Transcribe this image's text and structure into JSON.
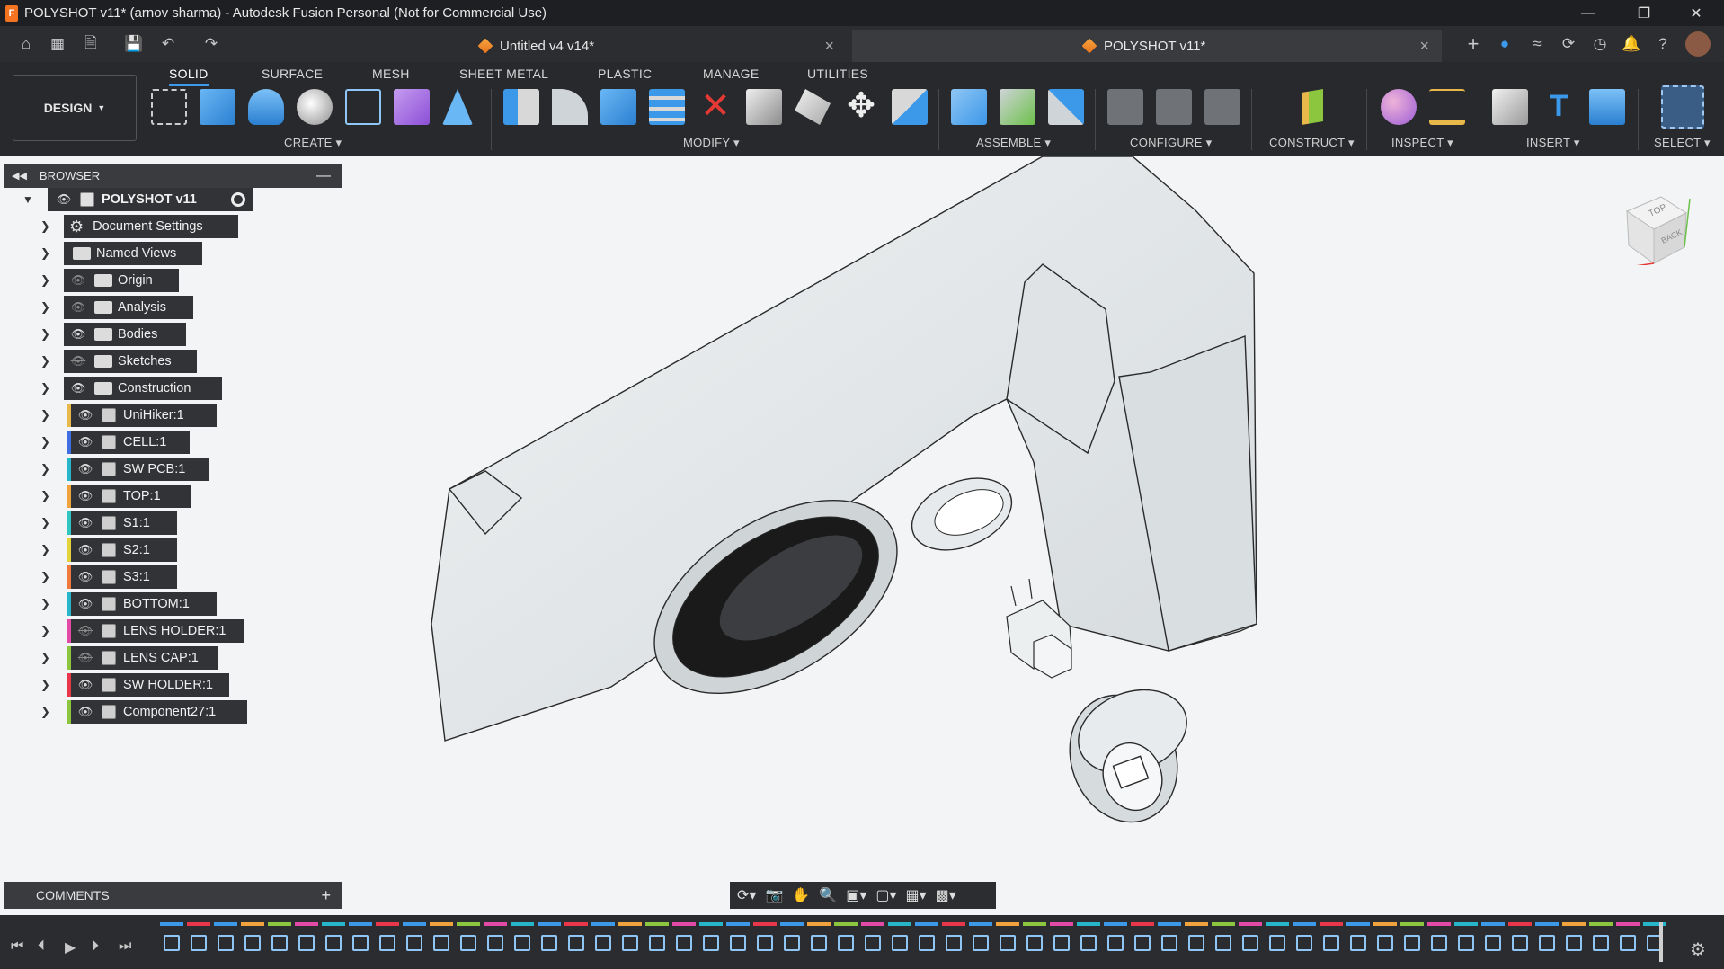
{
  "window": {
    "title": "POLYSHOT v11* (arnov sharma) - Autodesk Fusion Personal (Not for Commercial Use)",
    "app_icon_letter": "F",
    "controls": [
      "minimize",
      "restore",
      "close"
    ]
  },
  "tabs": [
    {
      "label": "Untitled v4 v14*",
      "active": false
    },
    {
      "label": "POLYSHOT v11*",
      "active": true
    }
  ],
  "ribbon": {
    "workspace": "DESIGN",
    "workspace_tabs": [
      "SOLID",
      "SURFACE",
      "MESH",
      "SHEET METAL",
      "PLASTIC",
      "MANAGE",
      "UTILITIES"
    ],
    "active_tab": "SOLID",
    "groups": [
      "CREATE",
      "MODIFY",
      "ASSEMBLE",
      "CONFIGURE",
      "CONSTRUCT",
      "INSPECT",
      "INSERT",
      "SELECT"
    ]
  },
  "browser": {
    "title": "BROWSER",
    "root": "POLYSHOT v11",
    "items": [
      {
        "label": "Document Settings",
        "icon": "gear-icon",
        "visible": null,
        "color": ""
      },
      {
        "label": "Named Views",
        "icon": "folder-icon",
        "visible": null,
        "color": ""
      },
      {
        "label": "Origin",
        "icon": "folder-icon",
        "visible": false,
        "color": ""
      },
      {
        "label": "Analysis",
        "icon": "folder-icon",
        "visible": false,
        "color": ""
      },
      {
        "label": "Bodies",
        "icon": "folder-icon",
        "visible": true,
        "color": ""
      },
      {
        "label": "Sketches",
        "icon": "folder-icon",
        "visible": false,
        "color": ""
      },
      {
        "label": "Construction",
        "icon": "folder-icon",
        "visible": true,
        "color": ""
      },
      {
        "label": "UniHiker:1",
        "icon": "component-icon",
        "visible": true,
        "color": "#e8b84a"
      },
      {
        "label": "CELL:1",
        "icon": "component-icon",
        "visible": true,
        "color": "#3e6ee0"
      },
      {
        "label": "SW PCB:1",
        "icon": "component-icon",
        "visible": true,
        "color": "#27b5c9"
      },
      {
        "label": "TOP:1",
        "icon": "component-icon",
        "visible": true,
        "color": "#f0a23c"
      },
      {
        "label": "S1:1",
        "icon": "component-icon",
        "visible": true,
        "color": "#2fc5c0"
      },
      {
        "label": "S2:1",
        "icon": "component-icon",
        "visible": true,
        "color": "#e3d23a"
      },
      {
        "label": "S3:1",
        "icon": "component-icon",
        "visible": true,
        "color": "#f07a3c"
      },
      {
        "label": "BOTTOM:1",
        "icon": "component-icon",
        "visible": true,
        "color": "#27b5c9"
      },
      {
        "label": "LENS HOLDER:1",
        "icon": "component-icon",
        "visible": false,
        "color": "#e24aa6"
      },
      {
        "label": "LENS CAP:1",
        "icon": "component-icon",
        "visible": false,
        "color": "#8cc63f"
      },
      {
        "label": "SW HOLDER:1",
        "icon": "component-icon",
        "visible": true,
        "color": "#e8364a"
      },
      {
        "label": "Component27:1",
        "icon": "assembly-icon",
        "visible": true,
        "color": "#8cc63f"
      }
    ]
  },
  "comments": {
    "title": "COMMENTS"
  },
  "viewcube": {
    "faces": [
      "TOP",
      "BACK"
    ]
  },
  "colors": {
    "accent": "#3c98e8",
    "panel_bg": "#323337",
    "viewport_bg": "#f2f4f5",
    "model_body": "#e4e8ea"
  }
}
